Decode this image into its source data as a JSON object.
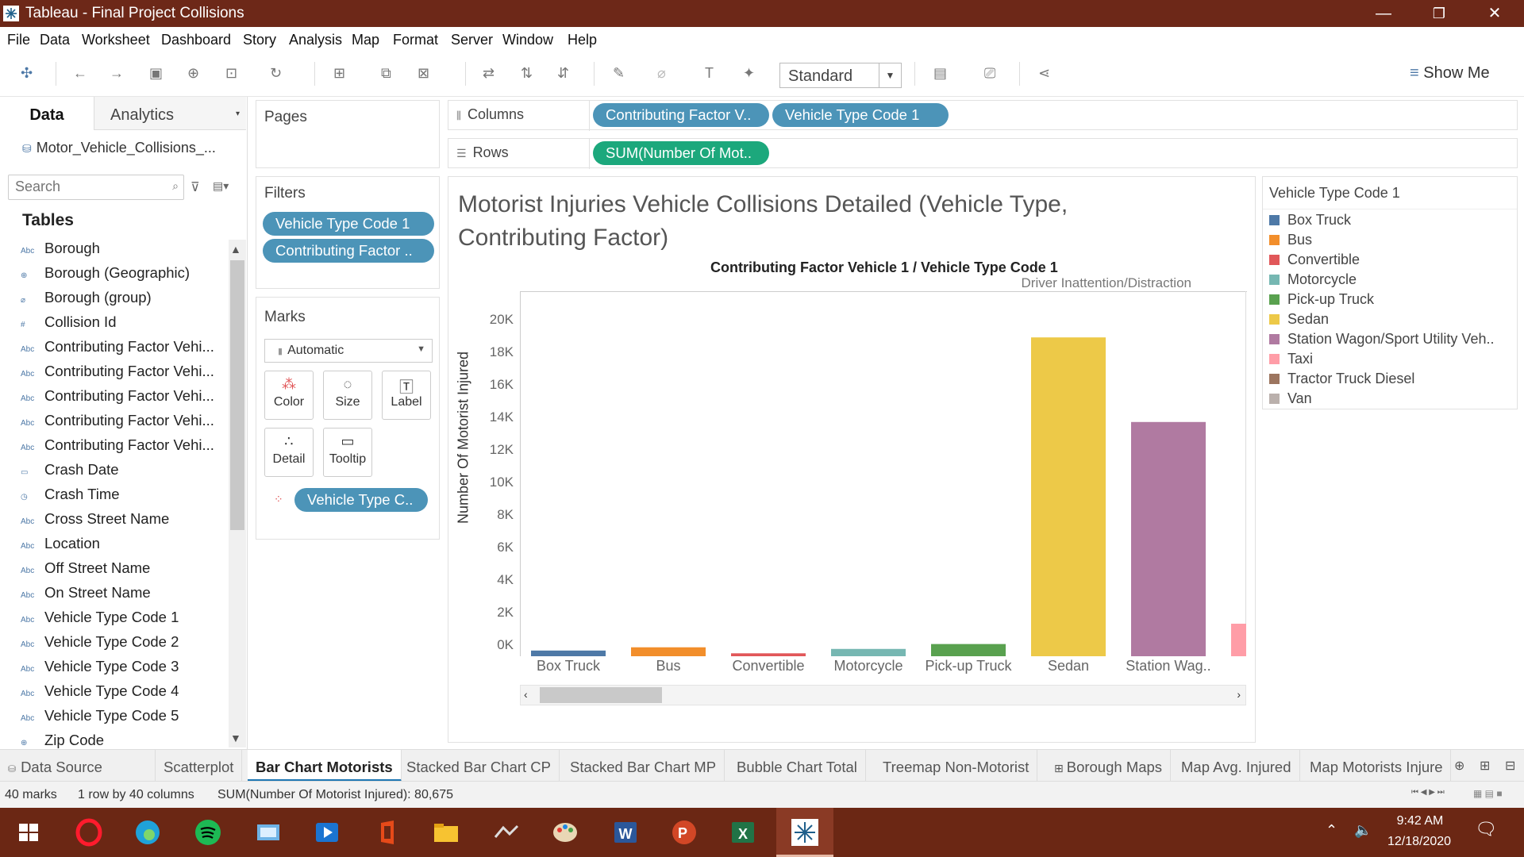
{
  "window": {
    "title": "Tableau - Final Project Collisions",
    "minimize": "—",
    "restore": "❐",
    "close": "✕"
  },
  "menu": [
    "File",
    "Data",
    "Worksheet",
    "Dashboard",
    "Story",
    "Analysis",
    "Map",
    "Format",
    "Server",
    "Window",
    "Help"
  ],
  "toolbar": {
    "fit_value": "Standard",
    "show_me": "Show Me"
  },
  "data_pane": {
    "tab_data": "Data",
    "tab_analytics": "Analytics",
    "datasource": "Motor_Vehicle_Collisions_...",
    "search_placeholder": "Search",
    "tables_heading": "Tables",
    "fields": [
      {
        "icon": "Abc",
        "name": "Borough"
      },
      {
        "icon": "globe",
        "name": "Borough (Geographic)"
      },
      {
        "icon": "clip",
        "name": "Borough (group)"
      },
      {
        "icon": "#",
        "name": "Collision Id"
      },
      {
        "icon": "Abc",
        "name": "Contributing Factor Vehi..."
      },
      {
        "icon": "Abc",
        "name": "Contributing Factor Vehi..."
      },
      {
        "icon": "Abc",
        "name": "Contributing Factor Vehi..."
      },
      {
        "icon": "Abc",
        "name": "Contributing Factor Vehi..."
      },
      {
        "icon": "Abc",
        "name": "Contributing Factor Vehi..."
      },
      {
        "icon": "cal",
        "name": "Crash Date"
      },
      {
        "icon": "caltime",
        "name": "Crash Time"
      },
      {
        "icon": "Abc",
        "name": "Cross Street Name"
      },
      {
        "icon": "Abc",
        "name": "Location"
      },
      {
        "icon": "Abc",
        "name": "Off Street Name"
      },
      {
        "icon": "Abc",
        "name": "On Street Name"
      },
      {
        "icon": "Abc",
        "name": "Vehicle Type Code 1"
      },
      {
        "icon": "Abc",
        "name": "Vehicle Type Code 2"
      },
      {
        "icon": "Abc",
        "name": "Vehicle Type Code 3"
      },
      {
        "icon": "Abc",
        "name": "Vehicle Type Code 4"
      },
      {
        "icon": "Abc",
        "name": "Vehicle Type Code 5"
      },
      {
        "icon": "globe",
        "name": "Zip Code"
      }
    ]
  },
  "pages": {
    "title": "Pages"
  },
  "filters": {
    "title": "Filters",
    "pills": [
      "Vehicle Type Code 1",
      "Contributing Factor .."
    ]
  },
  "marks": {
    "title": "Marks",
    "type": "Automatic",
    "buttons": [
      "Color",
      "Size",
      "Label",
      "Detail",
      "Tooltip"
    ],
    "color_pill": "Vehicle Type C.."
  },
  "columns": {
    "label": "Columns",
    "pills": [
      "Contributing Factor V..",
      "Vehicle Type Code 1"
    ]
  },
  "rows": {
    "label": "Rows",
    "pills": [
      "SUM(Number Of Mot.."
    ]
  },
  "chart_data": {
    "type": "bar",
    "title": "Motorist Injuries Vehicle Collisions Detailed (Vehicle Type, Contributing Factor)",
    "header": "Contributing Factor Vehicle 1  /  Vehicle Type Code 1",
    "group_label": "Driver Inattention/Distraction",
    "ylabel": "Number Of Motorist Injured",
    "ylim": [
      0,
      20000
    ],
    "yticks": [
      {
        "label": "0K",
        "value": 0
      },
      {
        "label": "2K",
        "value": 2000
      },
      {
        "label": "4K",
        "value": 4000
      },
      {
        "label": "6K",
        "value": 6000
      },
      {
        "label": "8K",
        "value": 8000
      },
      {
        "label": "10K",
        "value": 10000
      },
      {
        "label": "12K",
        "value": 12000
      },
      {
        "label": "14K",
        "value": 14000
      },
      {
        "label": "16K",
        "value": 16000
      },
      {
        "label": "18K",
        "value": 18000
      },
      {
        "label": "20K",
        "value": 20000
      }
    ],
    "categories": [
      "Box Truck",
      "Bus",
      "Convertible",
      "Motorcycle",
      "Pick-up Truck",
      "Sedan",
      "Station Wag.."
    ],
    "values": [
      350,
      550,
      180,
      450,
      750,
      19600,
      14400
    ],
    "colors": [
      "#4e79a7",
      "#f28e2b",
      "#e15759",
      "#76b7b2",
      "#59a14f",
      "#edc948",
      "#b07aa1"
    ],
    "partial_next_bar": {
      "value": 2000,
      "color": "#ff9da7"
    }
  },
  "legend": {
    "title": "Vehicle Type Code 1",
    "items": [
      {
        "name": "Box Truck",
        "color": "#4e79a7"
      },
      {
        "name": "Bus",
        "color": "#f28e2b"
      },
      {
        "name": "Convertible",
        "color": "#e15759"
      },
      {
        "name": "Motorcycle",
        "color": "#76b7b2"
      },
      {
        "name": "Pick-up Truck",
        "color": "#59a14f"
      },
      {
        "name": "Sedan",
        "color": "#edc948"
      },
      {
        "name": "Station Wagon/Sport Utility Veh..",
        "color": "#b07aa1"
      },
      {
        "name": "Taxi",
        "color": "#ff9da7"
      },
      {
        "name": "Tractor Truck Diesel",
        "color": "#9c755f"
      },
      {
        "name": "Van",
        "color": "#bab0ac"
      }
    ]
  },
  "sheet_tabs": {
    "data_source": "Data Source",
    "tabs": [
      "Scatterplot",
      "Bar Chart Motorists",
      "Stacked Bar Chart CP",
      "Stacked Bar Chart MP",
      "Bubble Chart Total",
      "Treemap Non-Motorist",
      "Borough Maps",
      "Map Avg. Injured",
      "Map Motorists Injure"
    ],
    "active": "Bar Chart Motorists"
  },
  "status": {
    "marks": "40 marks",
    "dims": "1 row by 40 columns",
    "sum": "SUM(Number Of Motorist Injured): 80,675"
  },
  "taskbar": {
    "time": "9:42 AM",
    "date": "12/18/2020"
  }
}
